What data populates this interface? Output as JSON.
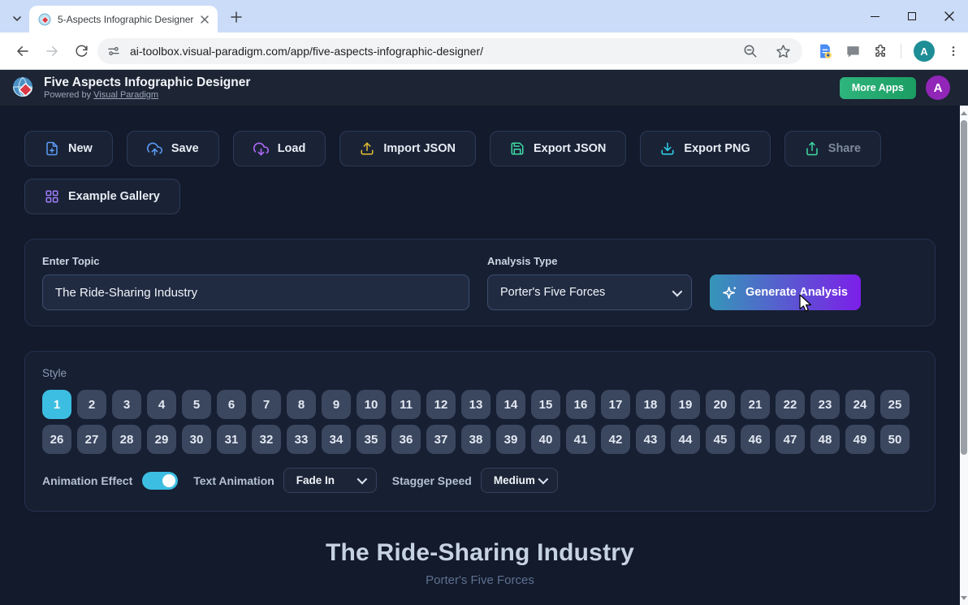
{
  "browser": {
    "tab_title": "5-Aspects Infographic Designer",
    "url": "ai-toolbox.visual-paradigm.com/app/five-aspects-infographic-designer/",
    "profile_initial": "A"
  },
  "header": {
    "title": "Five Aspects Infographic Designer",
    "powered_by": "Powered by",
    "powered_by_link": "Visual Paradigm",
    "more_apps": "More Apps",
    "avatar_initial": "A"
  },
  "toolbar": {
    "buttons": [
      {
        "label": "New",
        "icon": "file-plus-icon",
        "disabled": false
      },
      {
        "label": "Save",
        "icon": "cloud-upload-icon",
        "disabled": false
      },
      {
        "label": "Load",
        "icon": "cloud-download-icon",
        "disabled": false
      },
      {
        "label": "Import JSON",
        "icon": "upload-icon",
        "disabled": false
      },
      {
        "label": "Export JSON",
        "icon": "floppy-icon",
        "disabled": false
      },
      {
        "label": "Export PNG",
        "icon": "download-icon",
        "disabled": false
      },
      {
        "label": "Share",
        "icon": "share-icon",
        "disabled": true
      },
      {
        "label": "Example Gallery",
        "icon": "grid-icon",
        "disabled": false
      }
    ]
  },
  "topic_panel": {
    "topic_label": "Enter Topic",
    "topic_value": "The Ride-Sharing Industry",
    "analysis_label": "Analysis Type",
    "analysis_value": "Porter's Five Forces",
    "generate_label": "Generate Analysis"
  },
  "style_panel": {
    "label": "Style",
    "count": 50,
    "selected": 1,
    "animation_effect_label": "Animation Effect",
    "animation_on": true,
    "text_animation_label": "Text Animation",
    "text_animation_value": "Fade In",
    "stagger_speed_label": "Stagger Speed",
    "stagger_speed_value": "Medium"
  },
  "preview": {
    "title": "The Ride-Sharing Industry",
    "subtitle": "Porter's Five Forces"
  },
  "colors": {
    "accent_cyan": "#3cbee2",
    "gradient_start": "#3596b8",
    "gradient_end": "#7c1fe8",
    "green_start": "#2eb57d",
    "green_end": "#1b9d62",
    "avatar_purple": "#9126b8",
    "browser_avatar_teal": "#1e8e96"
  },
  "icons": {
    "window": [
      "minimize-icon",
      "maximize-icon",
      "close-icon"
    ],
    "browser": [
      "tab-search-icon",
      "new-tab-icon",
      "back-icon",
      "forward-icon",
      "reload-icon",
      "site-settings-icon",
      "zoom-out-icon",
      "bookmark-star-icon",
      "extension-doc-icon",
      "extension-chat-icon",
      "extensions-puzzle-icon",
      "kebab-menu-icon"
    ],
    "app": [
      "visual-paradigm-logo",
      "file-plus-icon",
      "cloud-upload-icon",
      "cloud-download-icon",
      "upload-icon",
      "floppy-icon",
      "download-icon",
      "share-icon",
      "grid-icon",
      "sparkle-icon",
      "chevron-down-icon"
    ]
  }
}
